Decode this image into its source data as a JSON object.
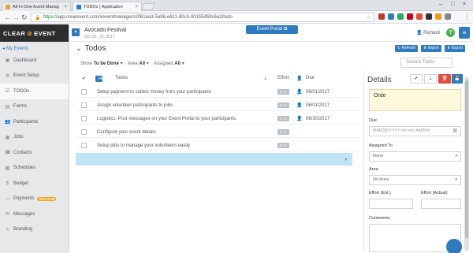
{
  "browser": {
    "tabs": [
      {
        "title": "All-In-One Event Manag",
        "favicon_color": "#e8a23a"
      },
      {
        "title": "TODOs | Application",
        "favicon_color": "#2e7bbf"
      }
    ],
    "url_https": "https://",
    "url_rest": "app.clearevent.com/#eventmanager/c0f61ea3-5a96-e611-80c3-00155d59c6a2/todo"
  },
  "sidebar": {
    "logo_a": "CLEAR",
    "logo_b": "EVENT",
    "my_events": "My Events",
    "items": [
      {
        "label": "Dashboard",
        "icon": "dashboard-icon",
        "glyph": "▣"
      },
      {
        "label": "Event Setup",
        "icon": "gear-icon",
        "glyph": "⚙"
      },
      {
        "label": "TODOs",
        "icon": "checklist-icon",
        "glyph": "☑"
      },
      {
        "label": "Forms",
        "icon": "forms-icon",
        "glyph": "▤"
      },
      {
        "label": "Participants",
        "icon": "users-icon",
        "glyph": "👥"
      },
      {
        "label": "Jobs",
        "icon": "briefcase-icon",
        "glyph": "▦"
      },
      {
        "label": "Contacts",
        "icon": "contacts-icon",
        "glyph": "☎"
      },
      {
        "label": "Schedules",
        "icon": "calendar-icon",
        "glyph": "▦"
      },
      {
        "label": "Budget",
        "icon": "dollar-icon",
        "glyph": "$"
      },
      {
        "label": "Payments",
        "icon": "payments-icon",
        "glyph": "▭",
        "badge": "Test Mode"
      },
      {
        "label": "Messages",
        "icon": "messages-icon",
        "glyph": "✉"
      },
      {
        "label": "Branding",
        "icon": "branding-icon",
        "glyph": "✎"
      }
    ]
  },
  "header": {
    "event_title": "Avocado Festival",
    "event_dates": "Oct 20 - 22, 2017",
    "portal_label": "Event Portal",
    "user_name": "Richard",
    "help_label": "?"
  },
  "todos": {
    "title": "Todos",
    "refresh": "Refresh",
    "import": "Import",
    "export": "Export",
    "show_label": "Show",
    "show_value": "To be Done",
    "area_label": "Area",
    "area_value": "All",
    "assigned_label": "Assigned",
    "assigned_value": "All",
    "search_placeholder": "Search Todos",
    "add_label": "Add",
    "col_todos": "Todos",
    "col_effort": "Effort",
    "col_due": "Due",
    "rows": [
      {
        "text": "Setup payment to collect money from your participants",
        "effort": "0 / 0",
        "due": "06/01/2017"
      },
      {
        "text": "Assign volunteer participants to jobs",
        "effort": "0 / 0",
        "due": "06/01/2017"
      },
      {
        "text": "Logistics: Post messages on your Event Portal to your participants",
        "effort": "1 / 2",
        "due": "06/30/2017"
      },
      {
        "text": "Configure your event details",
        "effort": "0 / 0",
        "due": ""
      },
      {
        "text": "Setup jobs to manage your volunteers easily",
        "effort": "0 / 0",
        "due": ""
      }
    ]
  },
  "details": {
    "title": "Details",
    "current_text": "Orde",
    "due_label": "Due",
    "due_placeholder": "MM/DD/YYYY hh:mm AM/PM",
    "assigned_label": "Assigned To",
    "assigned_value": "None",
    "area_label": "Area",
    "area_value": "No Area",
    "effort_est_label": "Effort (Est.)",
    "effort_actual_label": "Effort (Actual)",
    "comments_label": "Comments"
  },
  "colors": {
    "accent": "#2e7bbf",
    "delete": "#e14b3b",
    "highlight_row": "#bfe4f6"
  }
}
